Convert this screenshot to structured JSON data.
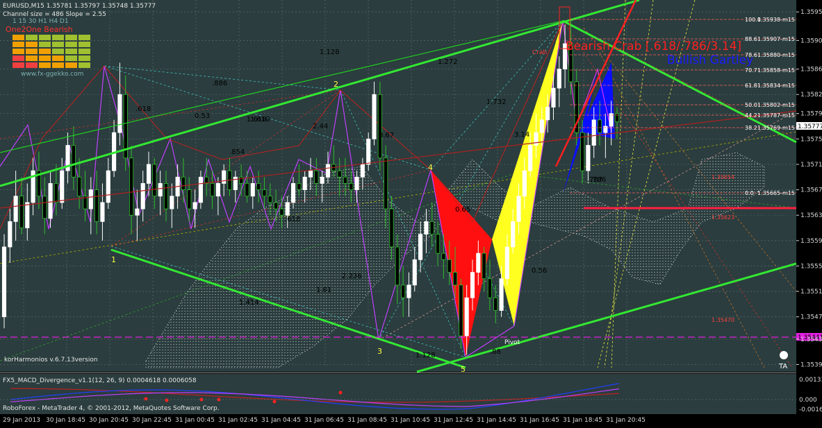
{
  "header": {
    "symbol_line": "EURUSD,M15  1.35781 1.35797 1.35748 1.35777",
    "channel_line": "Channel size = 486 Slope = 2.55",
    "tf_labels": "1  15  30  H1  H4  D1",
    "badge": "One2One Bearish",
    "site": "www.fx-ggekko.com"
  },
  "footer": {
    "indicator_version": "korHarmonios v.6.7.13version",
    "sub_label": "FX5_MACD_Divergence_v1.1(12, 26, 9) 0.0004618 0.0006058",
    "copyright": "RoboForex - MetaTrader 4, © 2001-2012, MetaQuotes Software Corp."
  },
  "patterns": {
    "bearish": "Bearish Crab [.618/.786/3.14]",
    "bullish": "Bullish Gartley",
    "crab_tag": "Crab",
    "pivot": "Pivot"
  },
  "colors": {
    "background": "#2b3d3e",
    "grid": "#5a6d6e",
    "bull": "#ffffff",
    "bear": "#2ec02e",
    "channel": "#33e833",
    "bearish_title": "#ff2020",
    "bullish_title": "#1a1aff",
    "red_fill": "#ff1010",
    "yellow_fill": "#ffff20",
    "blue_fill": "#0a10ff"
  },
  "chart_data": {
    "type": "candlestick",
    "symbol": "EURUSD",
    "timeframe": "M15",
    "ohlc_last": {
      "open": 1.35781,
      "high": 1.35797,
      "low": 1.35748,
      "close": 1.35777
    },
    "current_price": "1.35777",
    "ylim": [
      1.3539,
      1.3596
    ],
    "y_ticks": [
      "1.35950",
      "1.35905",
      "1.35860",
      "1.35820",
      "1.35790",
      "1.35750",
      "1.35710",
      "1.35670",
      "1.35630",
      "1.35590",
      "1.35550",
      "1.35510",
      "1.35470",
      "1.35435",
      "1.35395"
    ],
    "x_ticks": [
      "29 Jan 2013",
      "30 Jan 18:45",
      "30 Jan 20:45",
      "30 Jan 22:45",
      "31 Jan 00:45",
      "31 Jan 02:45",
      "31 Jan 04:45",
      "31 Jan 06:45",
      "31 Jan 08:45",
      "31 Jan 10:45",
      "31 Jan 12:45",
      "31 Jan 14:45",
      "31 Jan 16:45",
      "31 Jan 18:45",
      "31 Jan 20:45"
    ],
    "fib_levels": [
      {
        "label": "100.0",
        "price": "1.35938-m15"
      },
      {
        "label": "88.6",
        "price": "1.35907-m15"
      },
      {
        "label": "78.6",
        "price": "1.35880-m15"
      },
      {
        "label": "70.7",
        "price": "1.35858-m15"
      },
      {
        "label": "61.8",
        "price": "1.35834-m15"
      },
      {
        "label": "50.0",
        "price": "1.35802-m15"
      },
      {
        "label": "44.2",
        "price": "1.35787-m15"
      },
      {
        "label": "38.2",
        "price": "1.35769-m15"
      },
      {
        "label": "0.0",
        "price": "1.35665-m15"
      }
    ],
    "red_levels": [
      "1.35654",
      "1.35623",
      "1.35470"
    ],
    "magenta_level": "1.35441",
    "swing_labels": [
      "1",
      "2",
      "3",
      "4",
      "5"
    ],
    "fib_ratios": [
      "1.128",
      ".886",
      ".618",
      "0.53",
      "1.618",
      "1.272",
      ".854",
      "2.44",
      "0.67",
      "1.732",
      "3.14",
      ".786",
      "0.65",
      ".618",
      "1.81",
      "2.236",
      "1.414",
      "1.618",
      "0.56",
      "1.128",
      ".88",
      ".707"
    ],
    "macd_ticks": [
      "0.00133",
      "0.000",
      "-0.00162"
    ],
    "candles": [
      [
        1.3547,
        1.356,
        1.35452,
        1.3558
      ],
      [
        1.3558,
        1.3564,
        1.35555,
        1.3562
      ],
      [
        1.3562,
        1.357,
        1.3559,
        1.3566
      ],
      [
        1.3566,
        1.3569,
        1.356,
        1.3561
      ],
      [
        1.3561,
        1.3568,
        1.3559,
        1.3565
      ],
      [
        1.3565,
        1.3572,
        1.3563,
        1.357
      ],
      [
        1.357,
        1.3573,
        1.3564,
        1.3566
      ],
      [
        1.3566,
        1.3569,
        1.356,
        1.35625
      ],
      [
        1.35625,
        1.357,
        1.3561,
        1.3568
      ],
      [
        1.3568,
        1.3571,
        1.3563,
        1.3565
      ],
      [
        1.3565,
        1.3572,
        1.3564,
        1.357
      ],
      [
        1.357,
        1.3576,
        1.3568,
        1.3574
      ],
      [
        1.3574,
        1.3577,
        1.3567,
        1.3569
      ],
      [
        1.3569,
        1.3572,
        1.3564,
        1.3566
      ],
      [
        1.3566,
        1.357,
        1.3562,
        1.3564
      ],
      [
        1.3564,
        1.3569,
        1.356,
        1.3567
      ],
      [
        1.3567,
        1.357,
        1.356,
        1.3562
      ],
      [
        1.3562,
        1.3568,
        1.3559,
        1.3565
      ],
      [
        1.3565,
        1.3572,
        1.3564,
        1.357
      ],
      [
        1.357,
        1.3578,
        1.3569,
        1.3576
      ],
      [
        1.3576,
        1.3587,
        1.3574,
        1.3582
      ],
      [
        1.3582,
        1.3585,
        1.357,
        1.3572
      ],
      [
        1.3572,
        1.3574,
        1.356,
        1.3563
      ],
      [
        1.3563,
        1.3567,
        1.3559,
        1.3564
      ],
      [
        1.3564,
        1.357,
        1.3562,
        1.3568
      ],
      [
        1.3568,
        1.3573,
        1.3566,
        1.3571
      ],
      [
        1.3571,
        1.3572,
        1.3564,
        1.3566
      ],
      [
        1.3566,
        1.357,
        1.3563,
        1.3568
      ],
      [
        1.3568,
        1.357,
        1.3562,
        1.3564
      ],
      [
        1.3564,
        1.3568,
        1.3561,
        1.3566
      ],
      [
        1.3566,
        1.3571,
        1.3564,
        1.3569
      ],
      [
        1.3569,
        1.3572,
        1.3565,
        1.3567
      ],
      [
        1.3567,
        1.3569,
        1.3562,
        1.3564
      ],
      [
        1.3564,
        1.3567,
        1.3561,
        1.3565
      ],
      [
        1.3565,
        1.357,
        1.3564,
        1.3569
      ],
      [
        1.3569,
        1.3572,
        1.3566,
        1.3568
      ],
      [
        1.3568,
        1.357,
        1.3564,
        1.3566
      ],
      [
        1.3566,
        1.3569,
        1.3563,
        1.3568
      ],
      [
        1.3568,
        1.3571,
        1.3566,
        1.357
      ],
      [
        1.357,
        1.3572,
        1.3566,
        1.3567
      ],
      [
        1.3567,
        1.357,
        1.3565,
        1.3569
      ],
      [
        1.3569,
        1.3571,
        1.3566,
        1.3568
      ],
      [
        1.3568,
        1.357,
        1.3565,
        1.3566
      ],
      [
        1.3566,
        1.3569,
        1.3564,
        1.3568
      ],
      [
        1.3568,
        1.357,
        1.3565,
        1.3567
      ],
      [
        1.3567,
        1.3569,
        1.3564,
        1.3566
      ],
      [
        1.3566,
        1.3568,
        1.3563,
        1.3565
      ],
      [
        1.3565,
        1.3567,
        1.3562,
        1.3564
      ],
      [
        1.3564,
        1.3566,
        1.3561,
        1.3563
      ],
      [
        1.3563,
        1.3566,
        1.3561,
        1.3565
      ],
      [
        1.3565,
        1.3569,
        1.3564,
        1.3568
      ],
      [
        1.3568,
        1.3571,
        1.3566,
        1.3567
      ],
      [
        1.3567,
        1.357,
        1.3565,
        1.3569
      ],
      [
        1.3569,
        1.3572,
        1.3567,
        1.357
      ],
      [
        1.357,
        1.3572,
        1.3566,
        1.3568
      ],
      [
        1.3568,
        1.357,
        1.3565,
        1.3569
      ],
      [
        1.3569,
        1.3573,
        1.3568,
        1.3571
      ],
      [
        1.3571,
        1.3574,
        1.3569,
        1.357
      ],
      [
        1.357,
        1.3572,
        1.3566,
        1.3569
      ],
      [
        1.3569,
        1.3572,
        1.3566,
        1.3568
      ],
      [
        1.3568,
        1.357,
        1.3565,
        1.3567
      ],
      [
        1.3567,
        1.357,
        1.3565,
        1.3569
      ],
      [
        1.3569,
        1.3572,
        1.3567,
        1.3571
      ],
      [
        1.3571,
        1.3576,
        1.357,
        1.3575
      ],
      [
        1.3575,
        1.3584,
        1.3574,
        1.3582
      ],
      [
        1.3582,
        1.3584,
        1.357,
        1.3572
      ],
      [
        1.3572,
        1.3574,
        1.3561,
        1.3564
      ],
      [
        1.3564,
        1.3566,
        1.3556,
        1.3558
      ],
      [
        1.3558,
        1.356,
        1.3549,
        1.3552
      ],
      [
        1.3552,
        1.3555,
        1.3547,
        1.355
      ],
      [
        1.355,
        1.3554,
        1.3547,
        1.3552
      ],
      [
        1.3552,
        1.3558,
        1.3551,
        1.3556
      ],
      [
        1.3556,
        1.3562,
        1.3554,
        1.356
      ],
      [
        1.356,
        1.3564,
        1.3557,
        1.3562
      ],
      [
        1.3562,
        1.3565,
        1.3558,
        1.356
      ],
      [
        1.356,
        1.3562,
        1.3555,
        1.3557
      ],
      [
        1.3557,
        1.356,
        1.3553,
        1.3556
      ],
      [
        1.3556,
        1.3559,
        1.3552,
        1.3554
      ],
      [
        1.3554,
        1.3558,
        1.355,
        1.3552
      ],
      [
        1.3552,
        1.3553,
        1.3542,
        1.3544
      ],
      [
        1.3544,
        1.3552,
        1.3541,
        1.355
      ],
      [
        1.355,
        1.3556,
        1.3548,
        1.3554
      ],
      [
        1.3554,
        1.3559,
        1.3552,
        1.3557
      ],
      [
        1.3557,
        1.3558,
        1.3551,
        1.3553
      ],
      [
        1.3553,
        1.3556,
        1.3548,
        1.355
      ],
      [
        1.355,
        1.3552,
        1.3546,
        1.3548
      ],
      [
        1.3548,
        1.3555,
        1.3547,
        1.3553
      ],
      [
        1.3553,
        1.356,
        1.3552,
        1.3558
      ],
      [
        1.3558,
        1.3564,
        1.3557,
        1.3562
      ],
      [
        1.3562,
        1.3568,
        1.356,
        1.3566
      ],
      [
        1.3566,
        1.3572,
        1.3564,
        1.357
      ],
      [
        1.357,
        1.3576,
        1.3569,
        1.3574
      ],
      [
        1.3574,
        1.3579,
        1.3572,
        1.3576
      ],
      [
        1.3576,
        1.358,
        1.3574,
        1.3578
      ],
      [
        1.3578,
        1.3582,
        1.3576,
        1.358
      ],
      [
        1.358,
        1.3585,
        1.3578,
        1.3583
      ],
      [
        1.3583,
        1.3588,
        1.358,
        1.3586
      ],
      [
        1.3586,
        1.3593,
        1.3583,
        1.359
      ],
      [
        1.359,
        1.3594,
        1.3582,
        1.3584
      ],
      [
        1.3584,
        1.3586,
        1.3574,
        1.3576
      ],
      [
        1.3576,
        1.3578,
        1.3568,
        1.357
      ],
      [
        1.357,
        1.3576,
        1.3568,
        1.3574
      ],
      [
        1.3574,
        1.358,
        1.3572,
        1.3578
      ],
      [
        1.3578,
        1.3581,
        1.3574,
        1.3576
      ],
      [
        1.3576,
        1.3579,
        1.3572,
        1.3577
      ],
      [
        1.3577,
        1.3581,
        1.3574,
        1.3579
      ],
      [
        1.3579,
        1.358,
        1.3575,
        1.35777
      ]
    ]
  }
}
